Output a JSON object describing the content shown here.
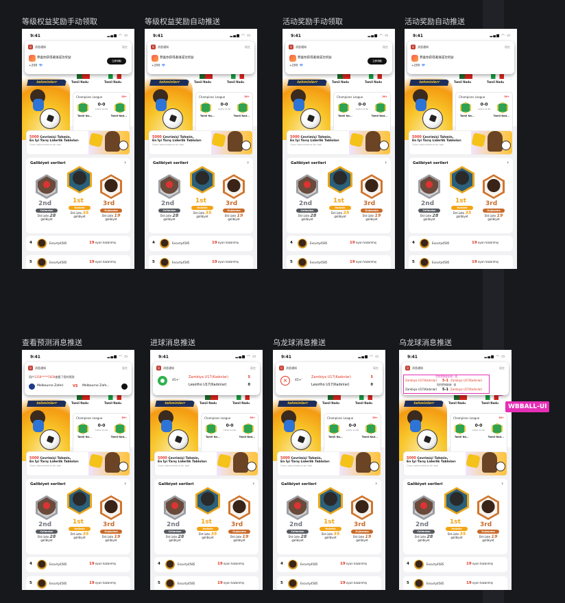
{
  "board": {
    "bg_color": "#16181c",
    "accent_color": "#e52fb5"
  },
  "mockups": [
    {
      "id": "m1",
      "title": "等级权益奖励手动领取",
      "type": "reward",
      "msg": "恭喜你获得邀请成功奖励",
      "reward": "+200",
      "button": "立即领取",
      "time": "现在"
    },
    {
      "id": "m2",
      "title": "等级权益奖励自动推送",
      "type": "reward",
      "msg": "恭喜你获得邀请成功奖励",
      "reward": "+200",
      "button": "",
      "time": "现在"
    },
    {
      "id": "m3",
      "title": "活动奖励手动领取",
      "type": "reward",
      "msg": "恭喜你获得邀请成功奖励",
      "reward": "+200",
      "button": "立即领取",
      "time": "现在"
    },
    {
      "id": "m4",
      "title": "活动奖励自动推送",
      "type": "reward",
      "msg": "恭喜你获得邀请成功奖励",
      "reward": "+200",
      "button": "",
      "time": "现在"
    },
    {
      "id": "m5",
      "title": "查看预测消息推送",
      "type": "prediction",
      "msg_prefix": "用户",
      "msg_user": "1358*****5658",
      "msg_suffix": "查看了您的预测",
      "team_a": "Melbourne Zaferi",
      "vs": "VS",
      "team_b": "Melbourne Zafe...",
      "time": "现在"
    },
    {
      "id": "m6",
      "title": "进球消息推送",
      "type": "goal",
      "minute": "45+'",
      "team_a": "Zambiya U17(Kadınlar)",
      "score_a": "5",
      "team_b": "Lesotho U17(Kadınlar)",
      "score_b": "0",
      "time": "现在"
    },
    {
      "id": "m7",
      "title": "乌龙球消息推送",
      "type": "own_goal",
      "minute": "45+'",
      "team_a": "Zambiya U17(Kadınlar)",
      "score_a": "5",
      "team_b": "Lesotho U17(Kadınlar)",
      "score_b": "0",
      "time": "现在"
    },
    {
      "id": "m8",
      "title": "乌龙球消息推送",
      "type": "wbball",
      "line1": "您的预测被反转！强",
      "t1": "Zambiya U17(Kadınlar)",
      "s1": "5-1",
      "t2": "Zambiya U17(Kadınlar)",
      "line2": "您的预测错误！强",
      "t3": "Zambiya U17(Kadınlar)",
      "s2": "5-1",
      "t4": "Zambiya U17(Kadınlar)",
      "time": "现在"
    }
  ],
  "annotation_label": "WBBALL-UI",
  "app": {
    "status_time": "9:41",
    "status_icons": "▂▄▆ ◠ ▭",
    "notif_app_name": "消息通知",
    "notif_app_icon": "Q",
    "hero_banner": "tahminlerr",
    "ticker_team_a": "Tamil Nadu",
    "ticker_team_b": "Tamil Nadu",
    "match_league": "Champions League",
    "match_live": "30+",
    "match_score": "0-0",
    "match_date": "10/12 11:30",
    "match_team_a": "Tamil Na...",
    "match_team_b": "Tamil Nad...",
    "dots": "• • •",
    "promo_amount": "5000",
    "promo_line1": " Çevrimiçi Tahmin,",
    "promo_line2": "En İyi Yarış Liderlik Tabloları",
    "promo_line3": "Onun tahminlerine bir bak",
    "podium_title": "Galibiyet serileri",
    "podium_arrow": "›",
    "p2_rank": "2nd",
    "p2_tag": "Cellmeizn",
    "p2_pre": "Üst üste",
    "p2_val": "28",
    "p2_post": "galibiyet",
    "p1_rank": "1st",
    "p1_tag": "Hailotle",
    "p1_pre": "Üst üste",
    "p1_val": "35",
    "p1_post": "galibiyet",
    "p3_rank": "3rd",
    "p3_tag": "Oujosama",
    "p3_pre": "Üst üste",
    "p3_val": "19",
    "p3_post": "galibiyet",
    "row1_rank": "4",
    "row1_user": "Excurty4585",
    "row1_val": "19",
    "row1_text": " oyun kazanmış",
    "row2_rank": "5",
    "row2_user": "Excurty4585",
    "row2_val": "19",
    "row2_text": " oyun kazanmış"
  }
}
